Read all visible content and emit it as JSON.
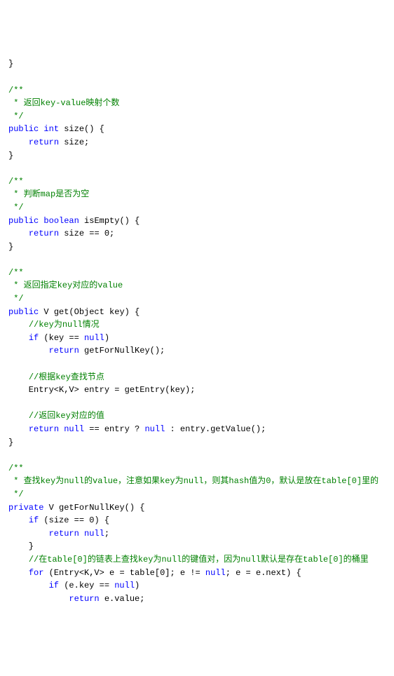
{
  "code": {
    "lines": [
      [
        {
          "t": "}",
          "c": ""
        }
      ],
      [],
      [
        {
          "t": "/**",
          "c": "cmt"
        }
      ],
      [
        {
          "t": " * 返回key-value映射个数",
          "c": "cmt"
        }
      ],
      [
        {
          "t": " */",
          "c": "cmt"
        }
      ],
      [
        {
          "t": "public",
          "c": "kw"
        },
        {
          "t": " ",
          "c": ""
        },
        {
          "t": "int",
          "c": "kw"
        },
        {
          "t": " size() {",
          "c": ""
        }
      ],
      [
        {
          "t": "    ",
          "c": ""
        },
        {
          "t": "return",
          "c": "kw"
        },
        {
          "t": " size;",
          "c": ""
        }
      ],
      [
        {
          "t": "}",
          "c": ""
        }
      ],
      [],
      [
        {
          "t": "/**",
          "c": "cmt"
        }
      ],
      [
        {
          "t": " * 判断map是否为空",
          "c": "cmt"
        }
      ],
      [
        {
          "t": " */",
          "c": "cmt"
        }
      ],
      [
        {
          "t": "public",
          "c": "kw"
        },
        {
          "t": " ",
          "c": ""
        },
        {
          "t": "boolean",
          "c": "kw"
        },
        {
          "t": " isEmpty() {",
          "c": ""
        }
      ],
      [
        {
          "t": "    ",
          "c": ""
        },
        {
          "t": "return",
          "c": "kw"
        },
        {
          "t": " size == ",
          "c": ""
        },
        {
          "t": "0",
          "c": "num"
        },
        {
          "t": ";",
          "c": ""
        }
      ],
      [
        {
          "t": "}",
          "c": ""
        }
      ],
      [],
      [
        {
          "t": "/**",
          "c": "cmt"
        }
      ],
      [
        {
          "t": " * 返回指定key对应的value",
          "c": "cmt"
        }
      ],
      [
        {
          "t": " */",
          "c": "cmt"
        }
      ],
      [
        {
          "t": "public",
          "c": "kw"
        },
        {
          "t": " V get(Object key) {",
          "c": ""
        }
      ],
      [
        {
          "t": "    ",
          "c": ""
        },
        {
          "t": "//key为null情况",
          "c": "cmt"
        }
      ],
      [
        {
          "t": "    ",
          "c": ""
        },
        {
          "t": "if",
          "c": "kw"
        },
        {
          "t": " (key == ",
          "c": ""
        },
        {
          "t": "null",
          "c": "kw"
        },
        {
          "t": ")",
          "c": ""
        }
      ],
      [
        {
          "t": "        ",
          "c": ""
        },
        {
          "t": "return",
          "c": "kw"
        },
        {
          "t": " getForNullKey();",
          "c": ""
        }
      ],
      [],
      [
        {
          "t": "    ",
          "c": ""
        },
        {
          "t": "//根据key查找节点",
          "c": "cmt"
        }
      ],
      [
        {
          "t": "    Entry<K,V> entry = getEntry(key);",
          "c": ""
        }
      ],
      [],
      [
        {
          "t": "    ",
          "c": ""
        },
        {
          "t": "//返回key对应的值",
          "c": "cmt"
        }
      ],
      [
        {
          "t": "    ",
          "c": ""
        },
        {
          "t": "return",
          "c": "kw"
        },
        {
          "t": " ",
          "c": ""
        },
        {
          "t": "null",
          "c": "kw"
        },
        {
          "t": " == entry ? ",
          "c": ""
        },
        {
          "t": "null",
          "c": "kw"
        },
        {
          "t": " : entry.getValue();",
          "c": ""
        }
      ],
      [
        {
          "t": "}",
          "c": ""
        }
      ],
      [],
      [
        {
          "t": "/**",
          "c": "cmt"
        }
      ],
      [
        {
          "t": " * 查找key为null的value，注意如果key为null，则其hash值为0，默认是放在table[0]里的",
          "c": "cmt"
        }
      ],
      [
        {
          "t": " */",
          "c": "cmt"
        }
      ],
      [
        {
          "t": "private",
          "c": "kw"
        },
        {
          "t": " V getForNullKey() {",
          "c": ""
        }
      ],
      [
        {
          "t": "    ",
          "c": ""
        },
        {
          "t": "if",
          "c": "kw"
        },
        {
          "t": " (size == ",
          "c": ""
        },
        {
          "t": "0",
          "c": "num"
        },
        {
          "t": ") {",
          "c": ""
        }
      ],
      [
        {
          "t": "        ",
          "c": ""
        },
        {
          "t": "return",
          "c": "kw"
        },
        {
          "t": " ",
          "c": ""
        },
        {
          "t": "null",
          "c": "kw"
        },
        {
          "t": ";",
          "c": ""
        }
      ],
      [
        {
          "t": "    }",
          "c": ""
        }
      ],
      [
        {
          "t": "    ",
          "c": ""
        },
        {
          "t": "//在table[0]的链表上查找key为null的键值对，因为null默认是存在table[0]的桶里",
          "c": "cmt"
        }
      ],
      [
        {
          "t": "    ",
          "c": ""
        },
        {
          "t": "for",
          "c": "kw"
        },
        {
          "t": " (Entry<K,V> e = table[",
          "c": ""
        },
        {
          "t": "0",
          "c": "num"
        },
        {
          "t": "]; e != ",
          "c": ""
        },
        {
          "t": "null",
          "c": "kw"
        },
        {
          "t": "; e = e.next) {",
          "c": ""
        }
      ],
      [
        {
          "t": "        ",
          "c": ""
        },
        {
          "t": "if",
          "c": "kw"
        },
        {
          "t": " (e.key == ",
          "c": ""
        },
        {
          "t": "null",
          "c": "kw"
        },
        {
          "t": ")",
          "c": ""
        }
      ],
      [
        {
          "t": "            ",
          "c": ""
        },
        {
          "t": "return",
          "c": "kw"
        },
        {
          "t": " e.value;",
          "c": ""
        }
      ]
    ]
  }
}
